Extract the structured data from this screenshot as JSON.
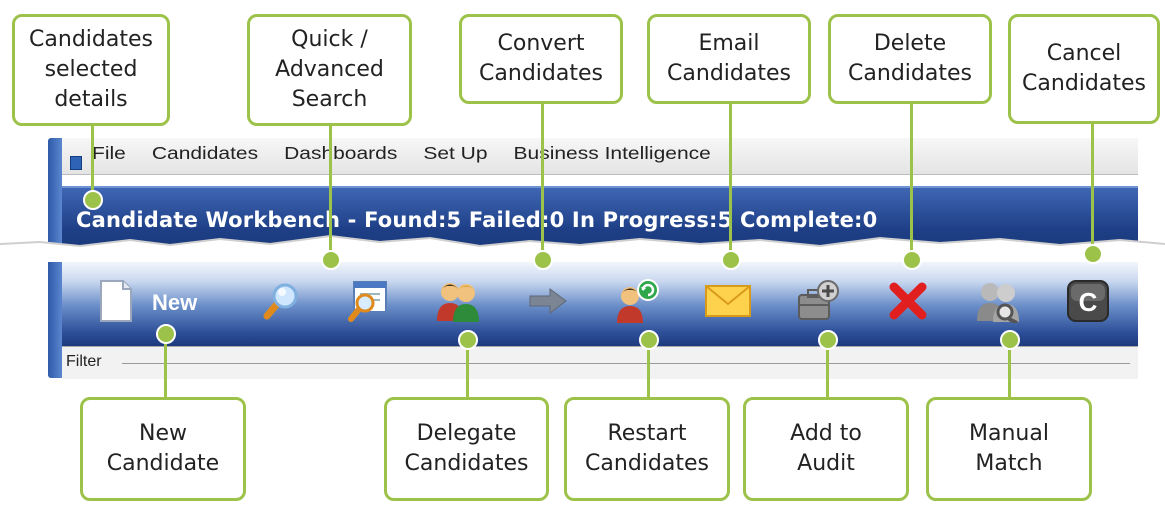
{
  "app": {
    "menu": [
      "File",
      "Candidates",
      "Dashboards",
      "Set Up",
      "Business Intelligence"
    ],
    "title": "Candidate Workbench - Found:5 Failed:0 In Progress:5 Complete:0",
    "toolbar": {
      "new_label": "New",
      "buttons": [
        "new-document-icon",
        "magnifier-icon",
        "advanced-search-icon",
        "delegate-people-icon",
        "convert-arrow-icon",
        "restart-person-icon",
        "envelope-icon",
        "add-audit-icon",
        "delete-x-icon",
        "manual-match-icon",
        "cancel-c-icon"
      ]
    },
    "filter_label": "Filter"
  },
  "callouts": {
    "selected_details": "Candidates\nselected\ndetails",
    "search": "Quick /\nAdvanced\nSearch",
    "convert": "Convert\nCandidates",
    "email": "Email\nCandidates",
    "delete": "Delete\nCandidates",
    "cancel": "Cancel\nCandidates",
    "new": "New\nCandidate",
    "delegate": "Delegate\nCandidates",
    "restart": "Restart\nCandidates",
    "audit": "Add to\nAudit",
    "manual_match": "Manual\nMatch"
  },
  "colors": {
    "callout_border": "#9cc24a",
    "title_bar": "#1e3f86",
    "toolbar": "#2d4f99"
  }
}
